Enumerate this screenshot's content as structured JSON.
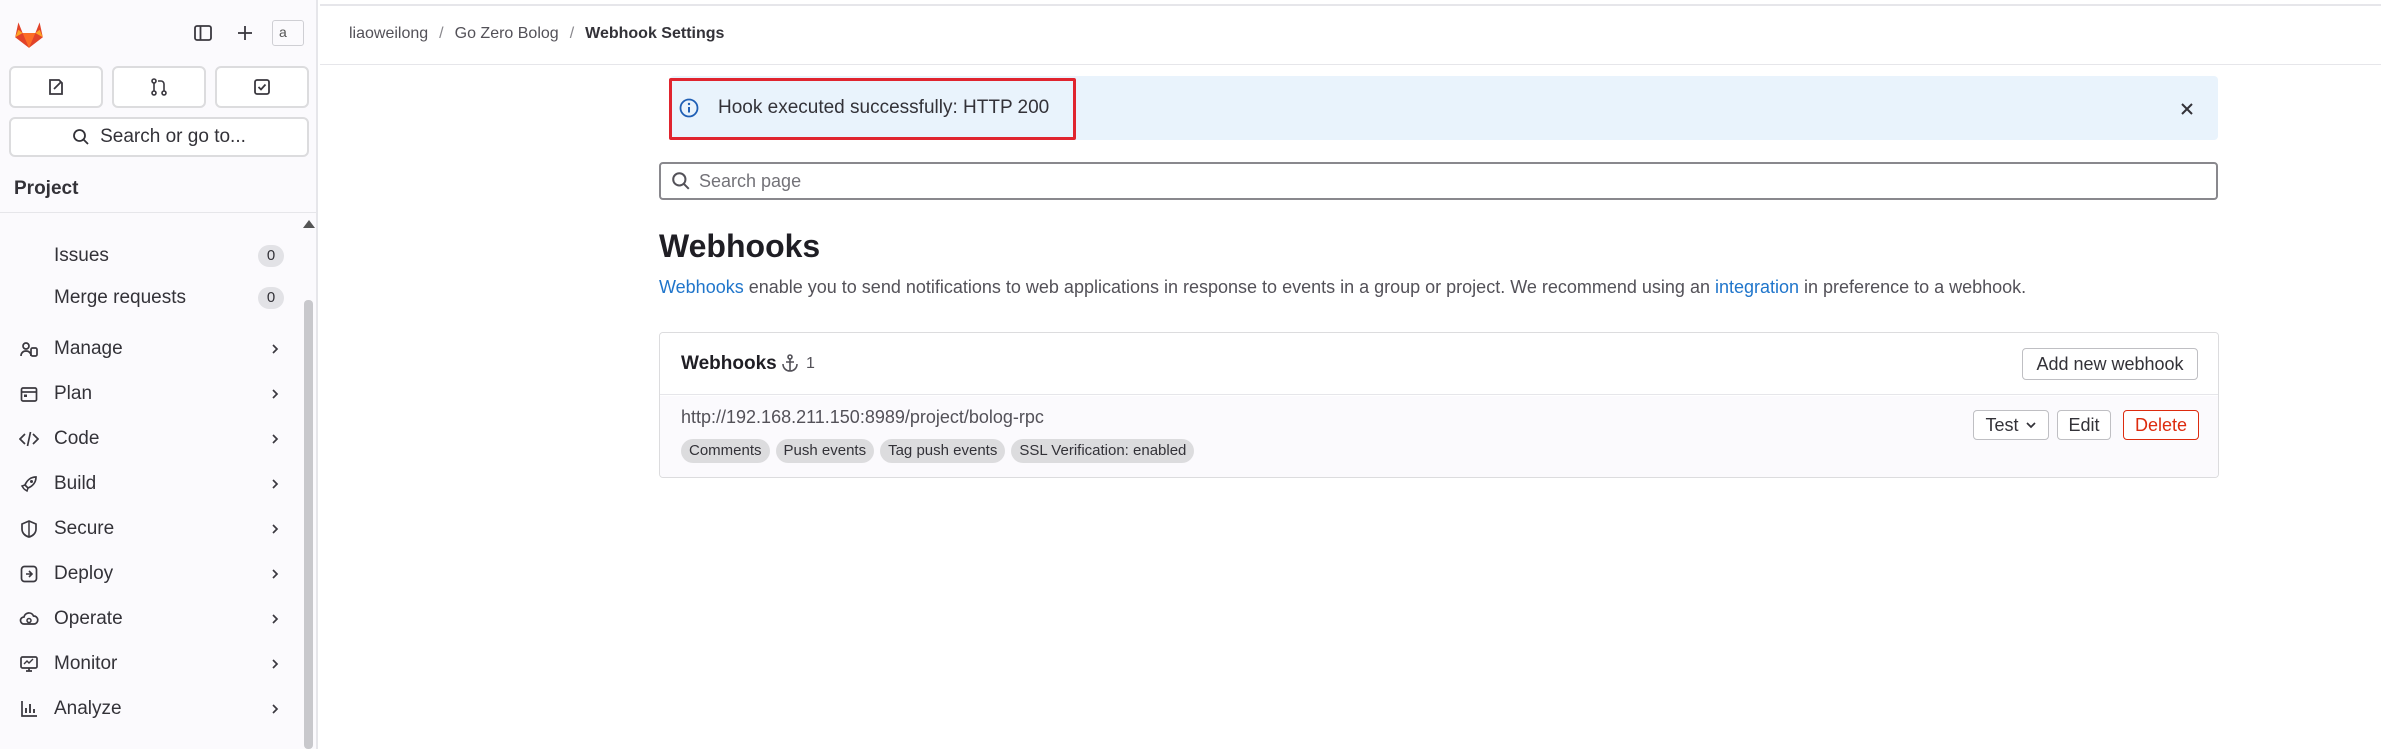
{
  "sidebar": {
    "avatar_alt": "a",
    "search_label": "Search or go to...",
    "section_title": "Project",
    "sub_items": [
      {
        "label": "Issues",
        "count": "0"
      },
      {
        "label": "Merge requests",
        "count": "0"
      }
    ],
    "nav_items": [
      {
        "label": "Manage",
        "icon": "users-icon"
      },
      {
        "label": "Plan",
        "icon": "calendar-icon"
      },
      {
        "label": "Code",
        "icon": "code-icon"
      },
      {
        "label": "Build",
        "icon": "rocket-icon"
      },
      {
        "label": "Secure",
        "icon": "shield-icon"
      },
      {
        "label": "Deploy",
        "icon": "deploy-icon"
      },
      {
        "label": "Operate",
        "icon": "cloud-gear-icon"
      },
      {
        "label": "Monitor",
        "icon": "monitor-icon"
      },
      {
        "label": "Analyze",
        "icon": "chart-icon"
      }
    ]
  },
  "breadcrumb": {
    "items": [
      "liaoweilong",
      "Go Zero Bolog",
      "Webhook Settings"
    ]
  },
  "alert": {
    "message": "Hook executed successfully: HTTP 200",
    "highlight_color": "#e0242e"
  },
  "page_search": {
    "placeholder": "Search page"
  },
  "main": {
    "title": "Webhooks",
    "desc_link1": "Webhooks",
    "desc_mid": " enable you to send notifications to web applications in response to events in a group or project. We recommend using an ",
    "desc_link2": "integration",
    "desc_end": " in preference to a webhook."
  },
  "webhooks_card": {
    "title": "Webhooks",
    "count": "1",
    "add_label": "Add new webhook",
    "hook": {
      "url": "http://192.168.211.150:8989/project/bolog-rpc",
      "tags": [
        "Comments",
        "Push events",
        "Tag push events",
        "SSL Verification: enabled"
      ],
      "test_label": "Test",
      "edit_label": "Edit",
      "delete_label": "Delete"
    }
  },
  "colors": {
    "accent": "#1f75cb",
    "danger": "#dd2b0e",
    "alert_bg": "#e9f3fc"
  }
}
